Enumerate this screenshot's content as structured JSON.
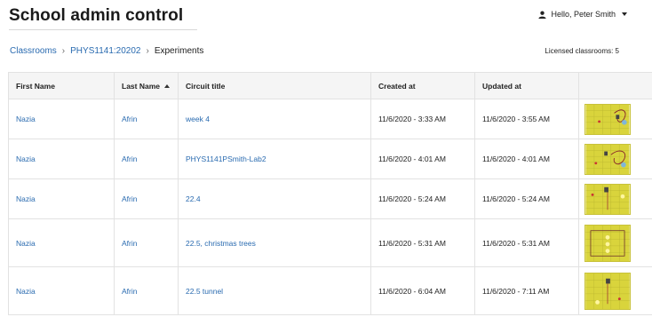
{
  "header": {
    "title": "School admin control",
    "user_greeting": "Hello, Peter Smith"
  },
  "breadcrumb": {
    "items": [
      "Classrooms",
      "PHYS1141:20202"
    ],
    "current": "Experiments"
  },
  "licensed_text": "Licensed classrooms: 5",
  "table": {
    "columns": [
      "First Name",
      "Last Name",
      "Circuit title",
      "Created at",
      "Updated at",
      ""
    ],
    "sorted_column": "Last Name",
    "sort_direction": "ascending",
    "rows": [
      {
        "first": "Nazia",
        "last": "Afrin",
        "title": "week 4",
        "created": "11/6/2020 - 3:33 AM",
        "updated": "11/6/2020 - 3:55 AM"
      },
      {
        "first": "Nazia",
        "last": "Afrin",
        "title": "PHYS1141PSmith-Lab2",
        "created": "11/6/2020 - 4:01 AM",
        "updated": "11/6/2020 - 4:01 AM"
      },
      {
        "first": "Nazia",
        "last": "Afrin",
        "title": "22.4",
        "created": "11/6/2020 - 5:24 AM",
        "updated": "11/6/2020 - 5:24 AM"
      },
      {
        "first": "Nazia",
        "last": "Afrin",
        "title": "22.5, christmas trees",
        "created": "11/6/2020 - 5:31 AM",
        "updated": "11/6/2020 - 5:31 AM"
      },
      {
        "first": "Nazia",
        "last": "Afrin",
        "title": "22.5 tunnel",
        "created": "11/6/2020 - 6:04 AM",
        "updated": "11/6/2020 - 7:11 AM"
      }
    ]
  },
  "colors": {
    "link": "#2a6bb0",
    "thumbnail_board": "#d9d43c"
  },
  "icons": {
    "user": "user-icon",
    "menu": "chevron-down-icon",
    "sort": "sort-ascending-icon"
  }
}
